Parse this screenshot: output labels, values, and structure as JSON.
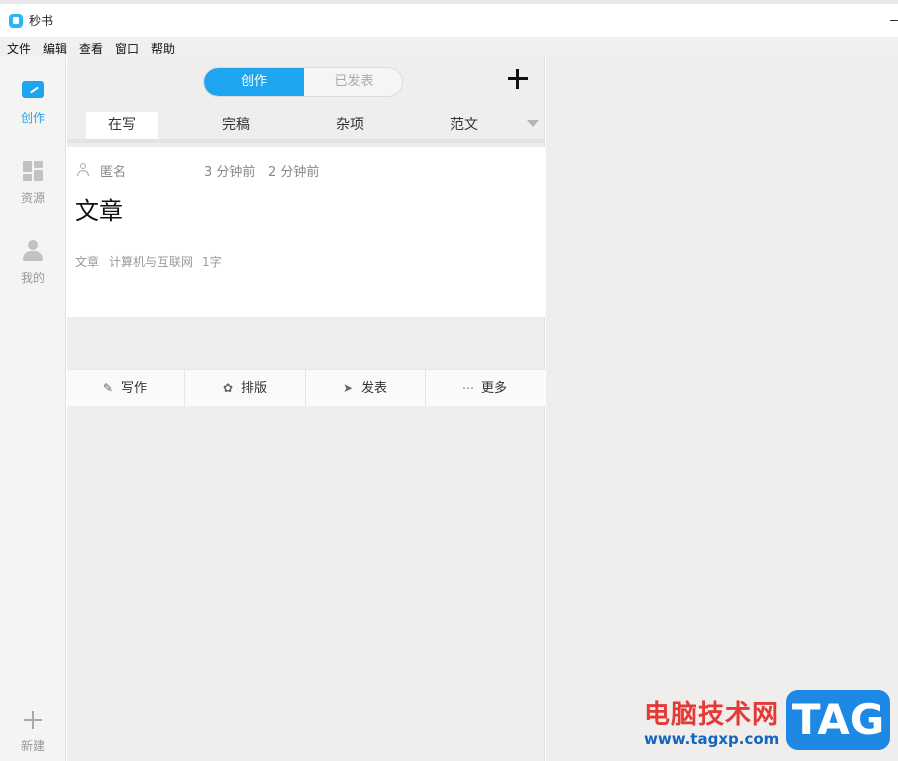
{
  "window": {
    "title": "秒书"
  },
  "menu": [
    "文件",
    "编辑",
    "查看",
    "窗口",
    "帮助"
  ],
  "sidebar": {
    "items": [
      {
        "label": "创作",
        "icon": "pen-icon",
        "active": true
      },
      {
        "label": "资源",
        "icon": "dashboard-icon",
        "active": false
      },
      {
        "label": "我的",
        "icon": "user-icon",
        "active": false
      }
    ],
    "new_label": "新建"
  },
  "segment": {
    "left": "创作",
    "right": "已发表",
    "selected": "创作"
  },
  "tabs": [
    {
      "label": "在写",
      "active": true
    },
    {
      "label": "完稿",
      "active": false
    },
    {
      "label": "杂项",
      "active": false
    },
    {
      "label": "范文",
      "active": false
    }
  ],
  "card": {
    "author": "匿名",
    "created": "3 分钟前",
    "modified": "2 分钟前",
    "title": "文章",
    "meta": [
      "文章",
      "计算机与互联网",
      "1字"
    ]
  },
  "actions": [
    {
      "label": "写作",
      "icon": "pencil-icon"
    },
    {
      "label": "排版",
      "icon": "palette-icon"
    },
    {
      "label": "发表",
      "icon": "send-icon"
    },
    {
      "label": "更多",
      "icon": "more-icon"
    }
  ],
  "watermark": {
    "cn": "电脑技术网",
    "url": "www.tagxp.com",
    "tag": "TAG"
  },
  "colors": {
    "accent": "#1ea5f0",
    "panel_bg": "#efeeec",
    "sidebar_bg": "#f4f4f2"
  }
}
